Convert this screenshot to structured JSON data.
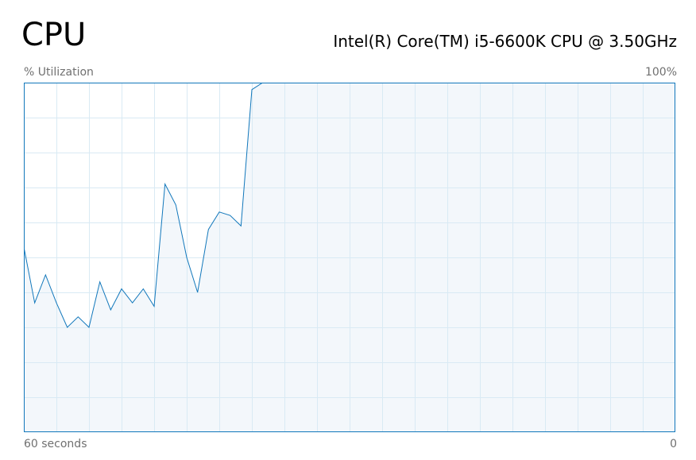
{
  "header": {
    "title": "CPU",
    "processor": "Intel(R) Core(TM) i5-6600K CPU @ 3.50GHz"
  },
  "graph": {
    "y_label": "% Utilization",
    "y_max_label": "100%",
    "x_start_label": "60 seconds",
    "x_end_label": "0"
  },
  "colors": {
    "line": "#1177bb",
    "fill": "#f1f6fa",
    "grid": "#d9eaf4",
    "border": "#1177bb"
  },
  "chart_data": {
    "type": "area",
    "title": "",
    "xlabel": "",
    "ylabel": "% Utilization",
    "xlim": [
      60,
      0
    ],
    "ylim": [
      0,
      100
    ],
    "grid": true,
    "series": [
      {
        "x": [
          60,
          59,
          58,
          57,
          56,
          55,
          54,
          53,
          52,
          51,
          50,
          49,
          48,
          47,
          46,
          45,
          44,
          43,
          42,
          41,
          40,
          39,
          38,
          37,
          36,
          35,
          34,
          33,
          32,
          31,
          30,
          29,
          28,
          27,
          26,
          25,
          24,
          23,
          22,
          21,
          20,
          19,
          18,
          17,
          16,
          15,
          14,
          13,
          12,
          11,
          10,
          9,
          8,
          7,
          6,
          5,
          4,
          3,
          2,
          1,
          0
        ],
        "values": [
          53,
          37,
          45,
          37,
          30,
          33,
          30,
          43,
          35,
          41,
          37,
          41,
          36,
          71,
          65,
          50,
          40,
          58,
          63,
          62,
          59,
          98,
          100,
          100,
          100,
          100,
          100,
          100,
          100,
          100,
          100,
          100,
          100,
          100,
          100,
          100,
          100,
          100,
          100,
          100,
          100,
          100,
          100,
          100,
          100,
          100,
          100,
          100,
          100,
          100,
          100,
          100,
          100,
          100,
          100,
          100,
          100,
          100,
          100,
          100,
          100
        ]
      }
    ]
  }
}
